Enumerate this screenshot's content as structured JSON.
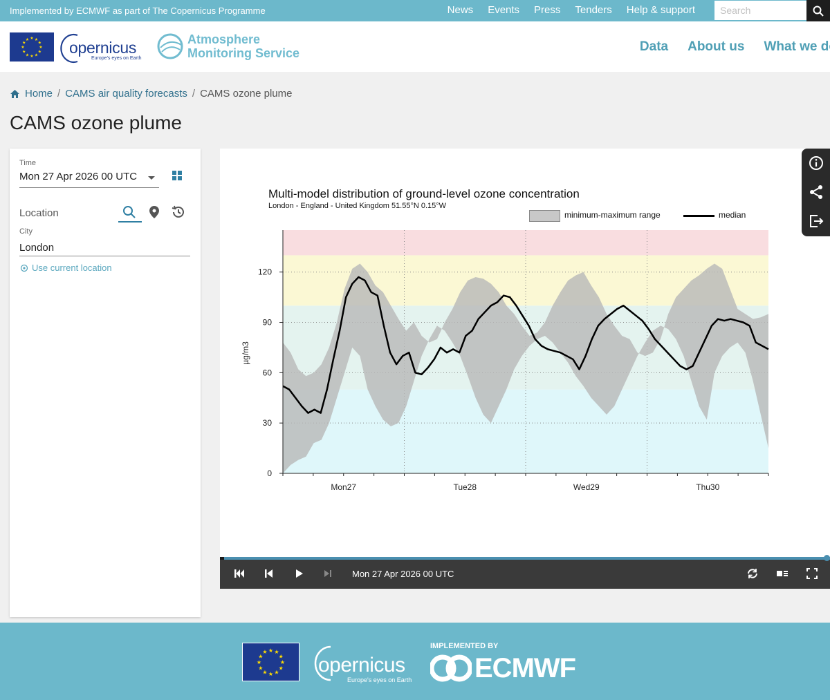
{
  "topbar": {
    "implemented_text": "Implemented by ECMWF as part of The Copernicus Programme",
    "nav": [
      "News",
      "Events",
      "Press",
      "Tenders",
      "Help & support"
    ],
    "search_placeholder": "Search"
  },
  "header": {
    "copernicus_word": "opernicus",
    "copernicus_tagline": "Europe's eyes on Earth",
    "service_line1": "Atmosphere",
    "service_line2": "Monitoring Service",
    "nav": [
      "Data",
      "About us",
      "What we do"
    ]
  },
  "breadcrumb": {
    "home": "Home",
    "parent": "CAMS air quality forecasts",
    "current": "CAMS ozone plume"
  },
  "page_title": "CAMS ozone plume",
  "controls": {
    "time_label": "Time",
    "time_value": "Mon 27 Apr 2026 00 UTC",
    "location_label": "Location",
    "city_label": "City",
    "city_value": "London",
    "use_current_location": "Use current location"
  },
  "chart_data": {
    "type": "area",
    "title": "Multi-model distribution of ground-level ozone concentration",
    "subtitle": "London - England - United Kingdom 51.55°N 0.15°W",
    "ylabel": "µg/m3",
    "ylim": [
      0,
      145
    ],
    "yticks": [
      0,
      30,
      60,
      90,
      120
    ],
    "xlabels": [
      "Mon27",
      "Tue28",
      "Wed29",
      "Thu30"
    ],
    "x_start_hour": -12,
    "x_step_hours": 3,
    "bands": [
      {
        "from": 0,
        "to": 50,
        "color": "#dff7fa"
      },
      {
        "from": 50,
        "to": 100,
        "color": "#e4f3ef"
      },
      {
        "from": 100,
        "to": 130,
        "color": "#fbf8d4"
      },
      {
        "from": 130,
        "to": 145,
        "color": "#f9dde0"
      }
    ],
    "series": [
      {
        "name": "minimum-maximum range",
        "kind": "range",
        "min": [
          0,
          5,
          8,
          10,
          18,
          20,
          30,
          45,
          60,
          75,
          70,
          50,
          40,
          32,
          28,
          30,
          40,
          55,
          70,
          80,
          88,
          85,
          78,
          70,
          58,
          45,
          35,
          30,
          40,
          50,
          62,
          70,
          76,
          80,
          82,
          78,
          72,
          66,
          58,
          52,
          45,
          40,
          35,
          40,
          50,
          60,
          70,
          78,
          85,
          88,
          86,
          80,
          70,
          55,
          40,
          32,
          60,
          70,
          75,
          78,
          72,
          55,
          35,
          15
        ],
        "max": [
          78,
          72,
          62,
          58,
          60,
          65,
          75,
          90,
          110,
          122,
          125,
          120,
          112,
          108,
          100,
          92,
          85,
          90,
          82,
          78,
          80,
          90,
          98,
          108,
          115,
          117,
          116,
          113,
          108,
          100,
          95,
          88,
          82,
          84,
          90,
          100,
          108,
          115,
          118,
          120,
          112,
          105,
          95,
          88,
          82,
          80,
          72,
          70,
          72,
          80,
          95,
          105,
          110,
          115,
          118,
          122,
          125,
          122,
          110,
          98,
          95,
          92,
          93,
          95
        ]
      },
      {
        "name": "median",
        "kind": "line",
        "values": [
          52,
          50,
          45,
          40,
          36,
          38,
          36,
          50,
          68,
          85,
          105,
          113,
          117,
          115,
          108,
          106,
          88,
          72,
          65,
          70,
          72,
          60,
          59,
          63,
          68,
          75,
          72,
          74,
          72,
          82,
          85,
          92,
          96,
          100,
          102,
          106,
          105,
          100,
          94,
          88,
          80,
          76,
          74,
          73,
          72,
          70,
          68,
          62,
          70,
          80,
          88,
          92,
          95,
          98,
          100,
          97,
          94,
          91,
          86,
          80,
          76,
          72,
          68,
          64,
          62,
          64,
          72,
          80,
          88,
          92,
          91,
          92,
          91,
          90,
          88,
          78,
          76,
          74
        ]
      }
    ],
    "legend": "top-right",
    "grid": true
  },
  "player": {
    "time": "Mon 27 Apr 2026 00 UTC",
    "progress": 1.0
  },
  "footer": {
    "copernicus_word": "opernicus",
    "copernicus_tagline": "Europe's eyes on Earth",
    "implemented_by": "IMPLEMENTED BY",
    "ecmwf": "ECMWF"
  },
  "icons": {
    "info": "info-icon",
    "share": "share-icon",
    "export": "export-icon"
  },
  "colors": {
    "brand": "#6cb8cb",
    "link": "#2f6f8c",
    "nav": "#4f9fb5"
  }
}
